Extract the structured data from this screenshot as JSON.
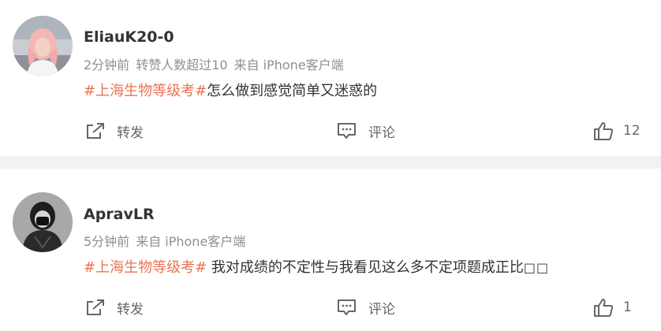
{
  "colors": {
    "hashtag": "#eb7350",
    "meta_text": "#8f8f8f",
    "separator": "#f2f2f2"
  },
  "posts": [
    {
      "username": "EliauK20-0",
      "time": "2分钟前",
      "extra": "转赞人数超过10",
      "source": "来自 iPhone客户端",
      "hashtag": "#上海生物等级考#",
      "text": "怎么做到感觉简单又迷惑的",
      "repost_label": "转发",
      "comment_label": "评论",
      "like_count": "12"
    },
    {
      "username": "ApravLR",
      "time": "5分钟前",
      "source": "来自 iPhone客户端",
      "hashtag": "#上海生物等级考#",
      "text": " 我对成绩的不定性与我看见这么多不定项题成正比",
      "trailing_glyphs": "□□",
      "repost_label": "转发",
      "comment_label": "评论",
      "like_count": "1"
    }
  ]
}
